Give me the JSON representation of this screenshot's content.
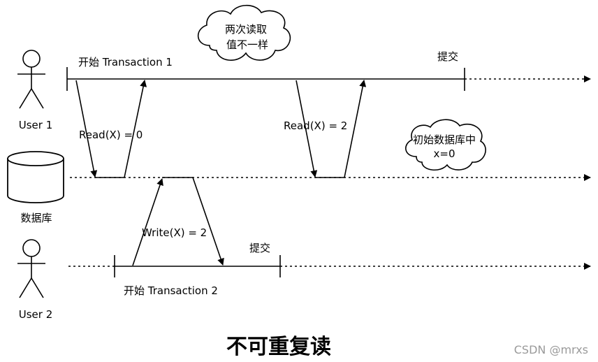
{
  "actors": {
    "user1": "User 1",
    "database": "数据库",
    "user2": "User 2"
  },
  "transaction1": {
    "start": "开始 Transaction 1",
    "commit": "提交",
    "read_first": "Read(X) = 0",
    "read_second": "Read(X) = 2"
  },
  "transaction2": {
    "start": "开始 Transaction 2",
    "commit": "提交",
    "write": "Write(X) = 2"
  },
  "notes": {
    "two_reads": [
      "两次读取",
      "值不一样"
    ],
    "initial": [
      "初始数据库中",
      "x=0"
    ]
  },
  "title": "不可重复读",
  "watermark": "CSDN @mrxs"
}
